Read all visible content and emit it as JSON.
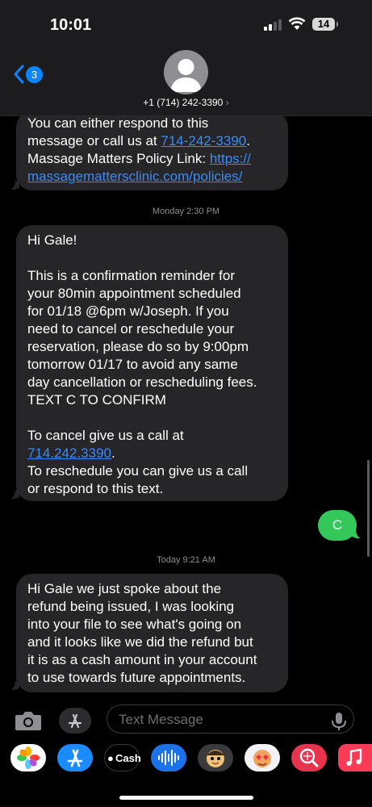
{
  "status_bar": {
    "time": "10:01",
    "battery": "14"
  },
  "header": {
    "back_badge": "3",
    "contact": "+1 (714) 242-3390",
    "chevron": "›"
  },
  "messages": {
    "m1": {
      "line1": "You can either respond to this",
      "line2a": "message or call us at ",
      "line2_link": "714-242-3390",
      "line2b": ".",
      "line3a": "Massage Matters Policy Link: ",
      "line3_link": "https://",
      "line4_link": "massagemattersclinic.com/policies/"
    },
    "ts1": "Monday 2:30 PM",
    "m2": {
      "greeting": "Hi Gale!",
      "body": "This is a confirmation reminder for\nyour 80min appointment scheduled\nfor 01/18 @6pm w/Joseph. If you\nneed to cancel or reschedule your\nreservation, please do so by 9:00pm\ntomorrow 01/17 to avoid any same\nday cancellation or rescheduling fees.\nTEXT C TO CONFIRM",
      "cancel": "To cancel give us a call at",
      "phone": "714.242.3390",
      "period": ".",
      "reschedule": "To reschedule you can give us a call\nor respond to this text."
    },
    "outgoing": "C",
    "ts2": "Today 9:21 AM",
    "m3": "Hi Gale we just spoke about the\nrefund being issued, I was looking\ninto your file to see what's going on\nand it looks like we did the refund but\nit is as a cash amount in your account\nto use towards future appointments."
  },
  "compose": {
    "placeholder": "Text Message"
  },
  "app_drawer": {
    "items": [
      {
        "icon": "photos-icon",
        "color": "#ffffff"
      },
      {
        "icon": "app-store-icon",
        "color": "#1a8cff"
      },
      {
        "label": "Cash",
        "icon": "apple-cash-icon",
        "color": "#000000"
      },
      {
        "icon": "audio-message-icon",
        "color": "#1a73e8"
      },
      {
        "icon": "memoji-icon",
        "color": "#e8c07a"
      },
      {
        "icon": "memoji-stickers-icon",
        "color": "#f5f5f5"
      },
      {
        "icon": "image-search-icon",
        "color": "#e8344e"
      },
      {
        "icon": "music-icon",
        "color": "#fb3b55"
      }
    ]
  },
  "colors": {
    "incoming": "#262628",
    "outgoing": "#34c759",
    "link": "#3a8bff"
  }
}
